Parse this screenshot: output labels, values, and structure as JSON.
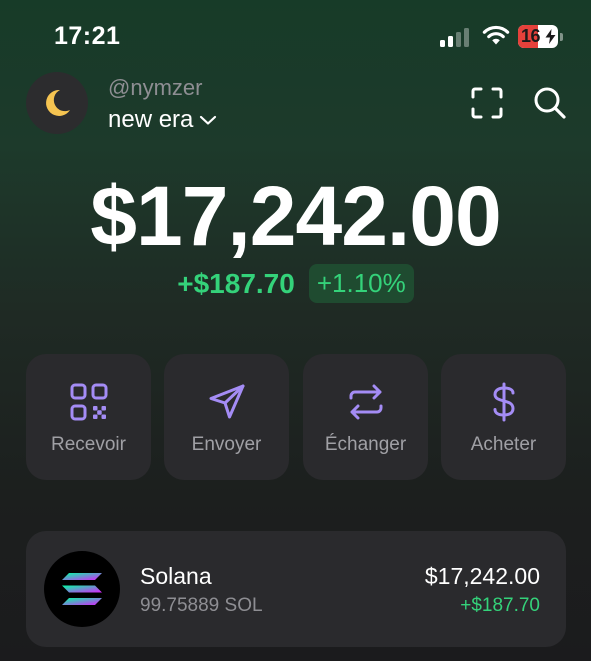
{
  "status_bar": {
    "time": "17:21",
    "battery_level": "16",
    "battery_color": "#e5413b",
    "icons": [
      "signal-icon",
      "wifi-icon",
      "battery-charging-icon"
    ]
  },
  "header": {
    "avatar_icon": "crescent-moon-icon",
    "handle": "@nymzer",
    "account_name": "new era",
    "account_dropdown_icon": "chevron-down-icon",
    "right_icons": [
      "scan-icon",
      "search-icon"
    ]
  },
  "balance": {
    "total": "$17,242.00",
    "change_amount": "+$187.70",
    "change_percent": "+1.10%",
    "positive_color": "#34d27a"
  },
  "actions": [
    {
      "label": "Recevoir",
      "icon": "qr-code-icon"
    },
    {
      "label": "Envoyer",
      "icon": "send-icon"
    },
    {
      "label": "Échanger",
      "icon": "swap-icon"
    },
    {
      "label": "Acheter",
      "icon": "dollar-icon"
    }
  ],
  "accent_color": "#a48cf5",
  "tokens": [
    {
      "name": "Solana",
      "quantity": "99.75889 SOL",
      "value": "$17,242.00",
      "change": "+$187.70",
      "icon": "solana-logo-icon"
    }
  ]
}
